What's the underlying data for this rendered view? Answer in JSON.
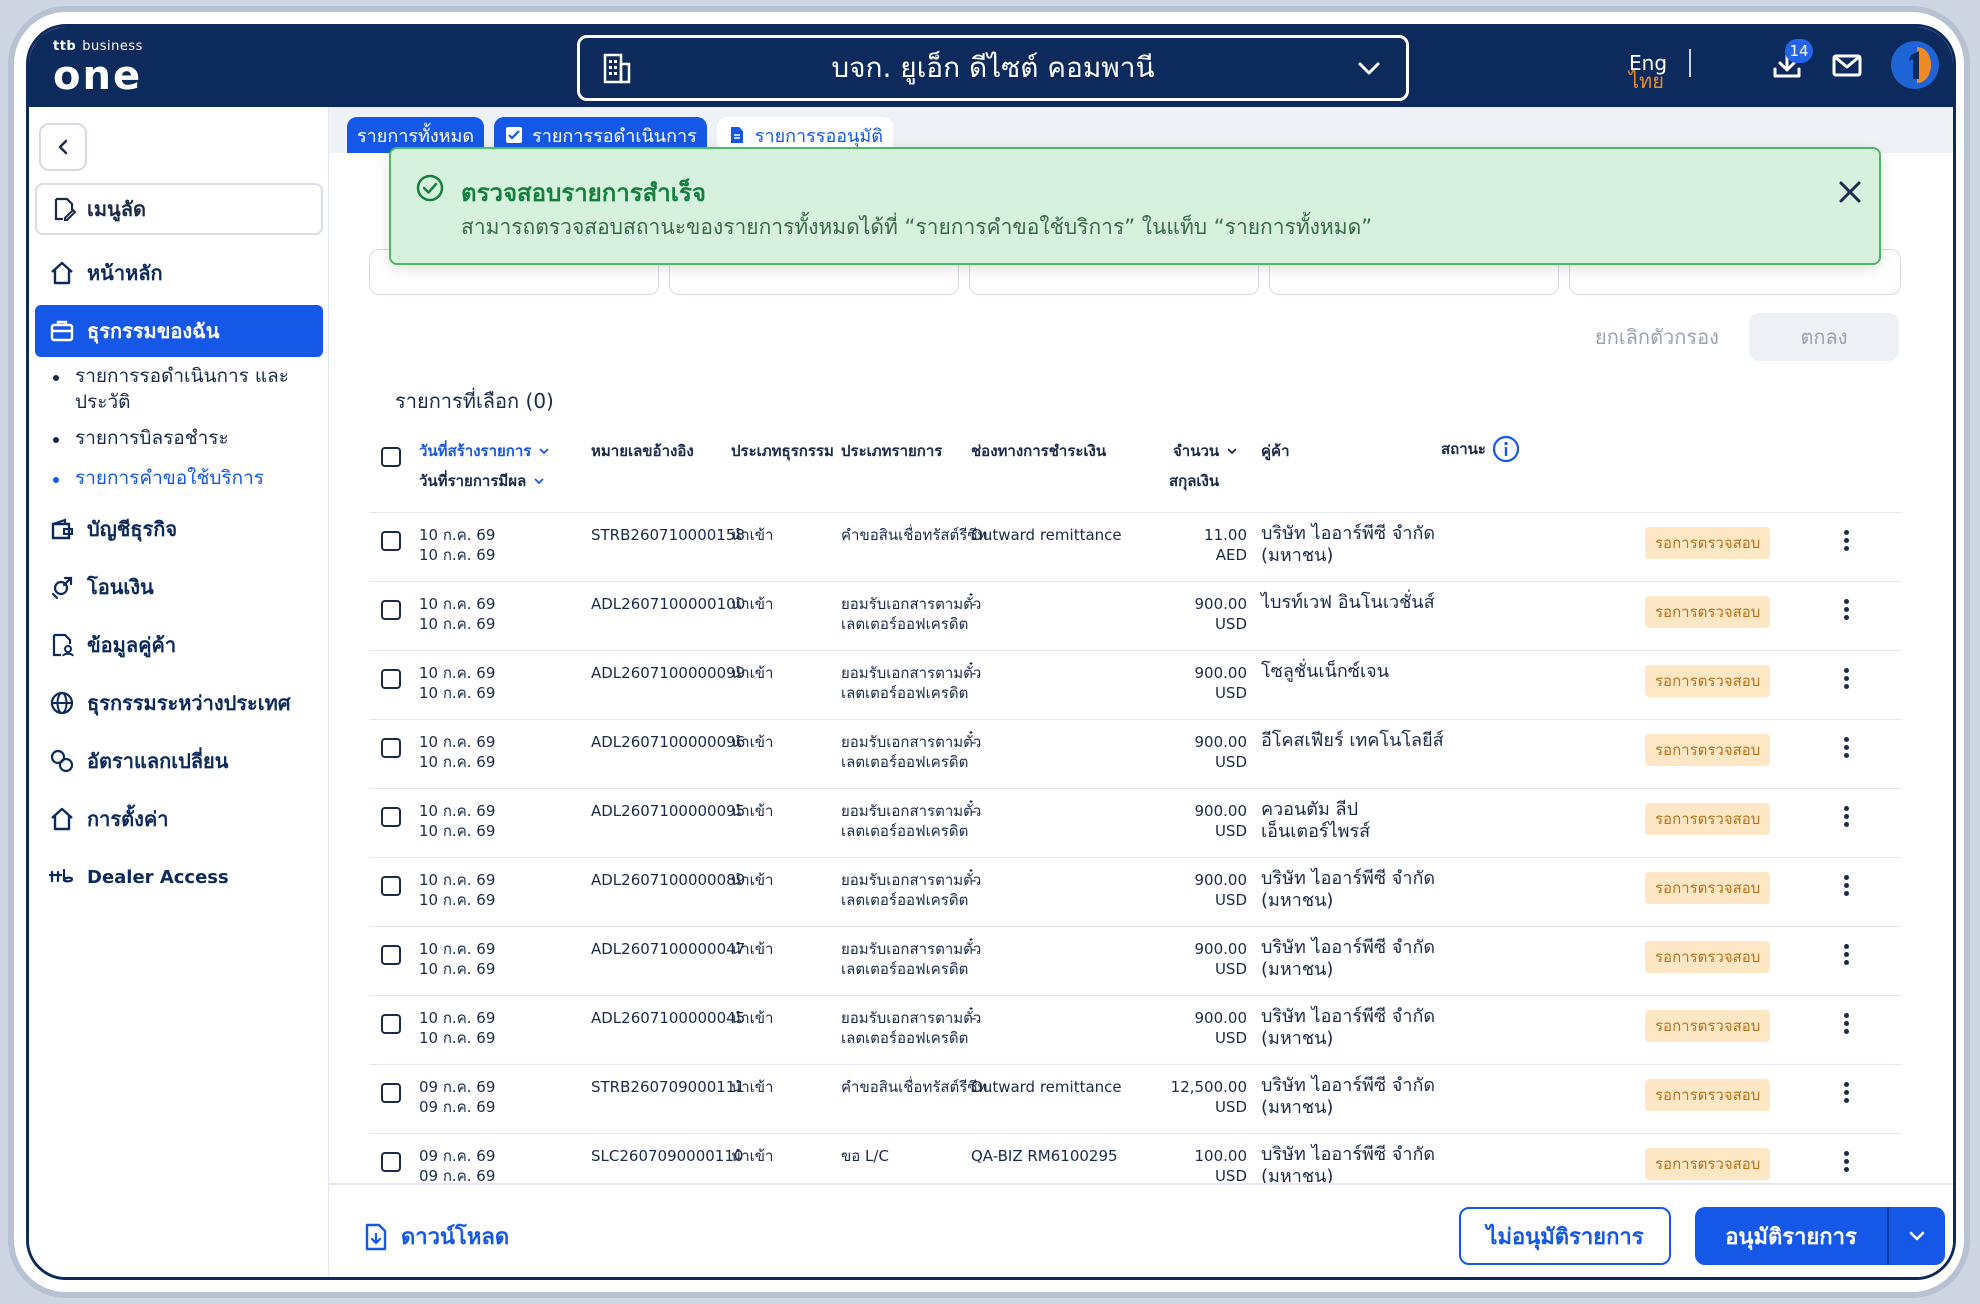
{
  "header": {
    "logo_small_brand": "ttb",
    "logo_small_text": "business",
    "logo_big": "one",
    "company_name": "บจก. ยูเอ็ก ดีไซต์ คอมพานี",
    "lang_en": "Eng",
    "lang_th": "ไทย",
    "download_badge": "14"
  },
  "sidebar": {
    "quick_menu": "เมนูลัด",
    "home": "หน้าหลัก",
    "my_transactions": "ธุรกรรมของฉัน",
    "sub_items": [
      "รายการรอดำเนินการ และประวัติ",
      "รายการบิลรอชำระ",
      "รายการคำขอใช้บริการ"
    ],
    "business_account": "บัญชีธุรกิจ",
    "transfer": "โอนเงิน",
    "partner_info": "ข้อมูลคู่ค้า",
    "international": "ธุรกรรมระหว่างประเทศ",
    "exchange_rate": "อัตราแลกเปลี่ยน",
    "settings": "การตั้งค่า",
    "dealer_access": "Dealer Access"
  },
  "tabs": [
    "รายการทั้งหมด",
    "รายการรอดำเนินการ",
    "รายการรออนุมัติ"
  ],
  "toast": {
    "title": "ตรวจสอบรายการสำเร็จ",
    "message": "สามารถตรวจสอบสถานะของรายการทั้งหมดได้ที่ “รายการคำขอใช้บริการ” ในแท็บ “รายการทั้งหมด”"
  },
  "filters": {
    "reset": "ยกเลิกตัวกรอง",
    "ok": "ตกลง"
  },
  "selected_count": "รายการที่เลือก (0)",
  "table": {
    "headers": {
      "created_date": "วันที่สร้างรายการ",
      "effective_date": "วันที่รายการมีผล",
      "reference": "หมายเลขอ้างอิง",
      "txn_type": "ประเภทธุรกรรม",
      "item_type": "ประเภทรายการ",
      "channel": "ช่องทางการชำระเงิน",
      "amount": "จำนวน",
      "currency": "สกุลเงิน",
      "partner": "คู่ค้า",
      "status": "สถานะ"
    },
    "rows": [
      {
        "d1": "10 ก.ค. 69",
        "d2": "10 ก.ค. 69",
        "ref": "STRB260710000158",
        "txn": "นำเข้า",
        "type": "คำขอสินเชื่อทรัสต์รีซีท",
        "type2": "",
        "channel": "Outward remittance",
        "amount": "11.00",
        "cur": "AED",
        "p1": "บริษัท ไออาร์พีซี จำกัด",
        "p2": "(มหาชน)",
        "status": "รอการตรวจสอบ"
      },
      {
        "d1": "10 ก.ค. 69",
        "d2": "10 ก.ค. 69",
        "ref": "ADL2607100000100",
        "txn": "นำเข้า",
        "type": "ยอมรับเอกสารตามตั๋ว",
        "type2": "เลตเตอร์ออฟเครดิต",
        "channel": "-",
        "amount": "900.00",
        "cur": "USD",
        "p1": "ไบรท์เวฟ อินโนเวชั่นส์",
        "p2": "",
        "status": "รอการตรวจสอบ"
      },
      {
        "d1": "10 ก.ค. 69",
        "d2": "10 ก.ค. 69",
        "ref": "ADL2607100000099",
        "txn": "นำเข้า",
        "type": "ยอมรับเอกสารตามตั๋ว",
        "type2": "เลตเตอร์ออฟเครดิต",
        "channel": "-",
        "amount": "900.00",
        "cur": "USD",
        "p1": "โซลูชั่นเน็กซ์เจน",
        "p2": "",
        "status": "รอการตรวจสอบ"
      },
      {
        "d1": "10 ก.ค. 69",
        "d2": "10 ก.ค. 69",
        "ref": "ADL2607100000096",
        "txn": "นำเข้า",
        "type": "ยอมรับเอกสารตามตั๋ว",
        "type2": "เลตเตอร์ออฟเครดิต",
        "channel": "-",
        "amount": "900.00",
        "cur": "USD",
        "p1": "อีโคสเฟียร์ เทคโนโลยีส์",
        "p2": "",
        "status": "รอการตรวจสอบ"
      },
      {
        "d1": "10 ก.ค. 69",
        "d2": "10 ก.ค. 69",
        "ref": "ADL2607100000095",
        "txn": "นำเข้า",
        "type": "ยอมรับเอกสารตามตั๋ว",
        "type2": "เลตเตอร์ออฟเครดิต",
        "channel": "-",
        "amount": "900.00",
        "cur": "USD",
        "p1": "ควอนตัม ลีป",
        "p2": "เอ็นเตอร์ไพรส์",
        "status": "รอการตรวจสอบ"
      },
      {
        "d1": "10 ก.ค. 69",
        "d2": "10 ก.ค. 69",
        "ref": "ADL2607100000089",
        "txn": "นำเข้า",
        "type": "ยอมรับเอกสารตามตั๋ว",
        "type2": "เลตเตอร์ออฟเครดิต",
        "channel": "-",
        "amount": "900.00",
        "cur": "USD",
        "p1": "บริษัท ไออาร์พีซี จำกัด",
        "p2": "(มหาชน)",
        "status": "รอการตรวจสอบ"
      },
      {
        "d1": "10 ก.ค. 69",
        "d2": "10 ก.ค. 69",
        "ref": "ADL2607100000047",
        "txn": "นำเข้า",
        "type": "ยอมรับเอกสารตามตั๋ว",
        "type2": "เลตเตอร์ออฟเครดิต",
        "channel": "-",
        "amount": "900.00",
        "cur": "USD",
        "p1": "บริษัท ไออาร์พีซี จำกัด",
        "p2": "(มหาชน)",
        "status": "รอการตรวจสอบ"
      },
      {
        "d1": "10 ก.ค. 69",
        "d2": "10 ก.ค. 69",
        "ref": "ADL2607100000045",
        "txn": "นำเข้า",
        "type": "ยอมรับเอกสารตามตั๋ว",
        "type2": "เลตเตอร์ออฟเครดิต",
        "channel": "-",
        "amount": "900.00",
        "cur": "USD",
        "p1": "บริษัท ไออาร์พีซี จำกัด",
        "p2": "(มหาชน)",
        "status": "รอการตรวจสอบ"
      },
      {
        "d1": "09 ก.ค. 69",
        "d2": "09 ก.ค. 69",
        "ref": "STRB260709000111",
        "txn": "นำเข้า",
        "type": "คำขอสินเชื่อทรัสต์รีซีท",
        "type2": "",
        "channel": "Outward remittance",
        "amount": "12,500.00",
        "cur": "USD",
        "p1": "บริษัท ไออาร์พีซี จำกัด",
        "p2": "(มหาชน)",
        "status": "รอการตรวจสอบ"
      },
      {
        "d1": "09 ก.ค. 69",
        "d2": "09 ก.ค. 69",
        "ref": "SLC2607090000110",
        "txn": "นำเข้า",
        "type": "ขอ L/C",
        "type2": "",
        "channel": "QA-BIZ RM6100295",
        "amount": "100.00",
        "cur": "USD",
        "p1": "บริษัท ไออาร์พีซี จำกัด",
        "p2": "(มหาชน)",
        "status": "รอการตรวจสอบ"
      }
    ]
  },
  "footer": {
    "download": "ดาวน์โหลด",
    "reject": "ไม่อนุมัติรายการ",
    "approve": "อนุมัติรายการ"
  },
  "colors": {
    "navy": "#0d2a5c",
    "primary": "#1557e6",
    "success_bg": "#d6f1dd",
    "status_bg": "#fde7c4",
    "accent_orange": "#f08a24"
  }
}
